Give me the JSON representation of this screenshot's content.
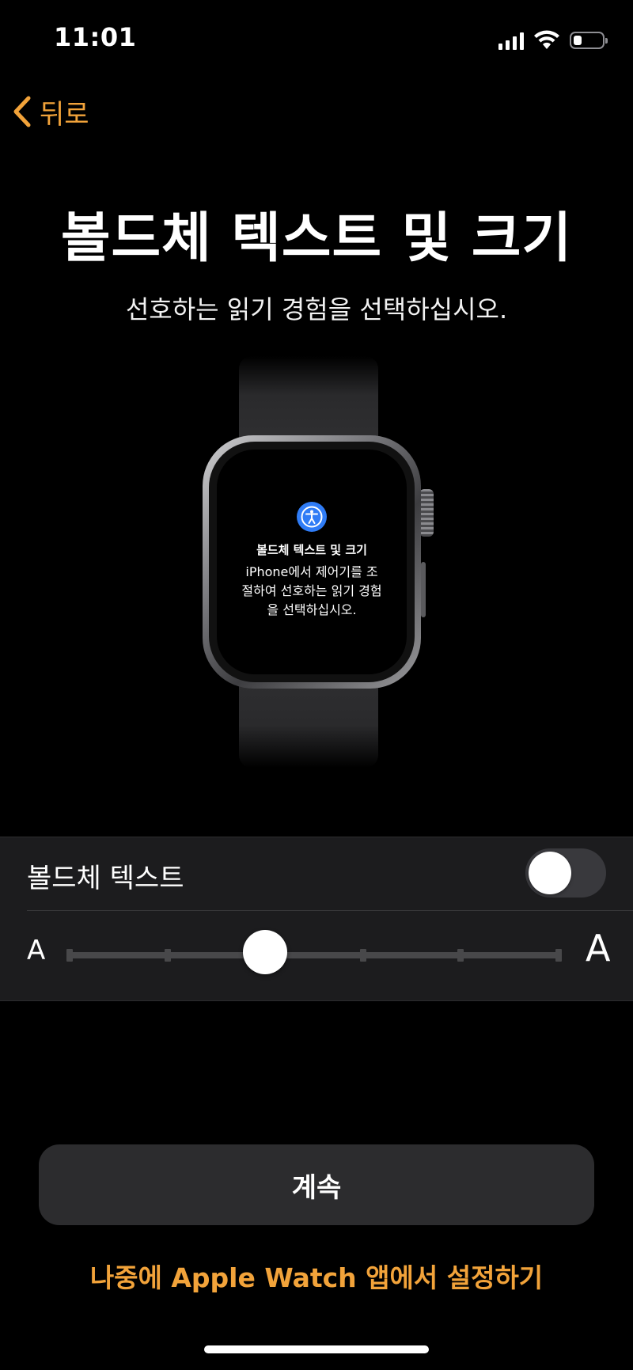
{
  "status_bar": {
    "time": "11:01",
    "battery_level": 0.3
  },
  "nav": {
    "back_label": "뒤로",
    "accent_color": "#f2a33a"
  },
  "header": {
    "title": "볼드체 텍스트 및 크기",
    "subtitle": "선호하는 읽기 경험을 선택하십시오."
  },
  "watch_preview": {
    "icon": "accessibility-icon",
    "title": "볼드체 텍스트 및 크기",
    "body": "iPhone에서 제어기를 조절하여 선호하는 읽기 경험을 선택하십시오."
  },
  "settings": {
    "bold_text_label": "볼드체 텍스트",
    "bold_text_enabled": false,
    "text_size": {
      "small_label": "A",
      "large_label": "A",
      "steps": 6,
      "selected_step": 2
    }
  },
  "actions": {
    "continue_label": "계속",
    "later_label": "나중에 Apple Watch 앱에서 설정하기"
  }
}
